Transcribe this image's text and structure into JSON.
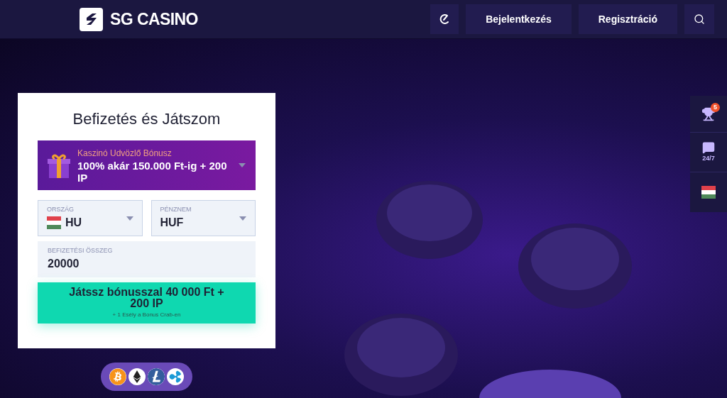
{
  "header": {
    "logo_text": "SG CASINO",
    "buttons": [
      "Bejelentkezés",
      "Regisztráció"
    ]
  },
  "form": {
    "title": "Befizetés és Játszom",
    "bonus": {
      "label": "Kaszinó Udvözlő Bónusz",
      "text": "100% akár 150.000 Ft-ig + 200 IP"
    },
    "country": {
      "label": "ORSZÁG",
      "value": "HU"
    },
    "currency": {
      "label": "PÉNZNEM",
      "value": "HUF"
    },
    "amount": {
      "label": "BEFIZETÉSI ÖSSZEG",
      "value": "20000"
    },
    "cta": {
      "title": "Játssz bónusszal 40 000 Ft + 200 IP",
      "subtitle": "+ 1 Esély a Bonus Crab-en"
    }
  },
  "side_panel": {
    "badge": "5",
    "support_label": "24/7"
  }
}
